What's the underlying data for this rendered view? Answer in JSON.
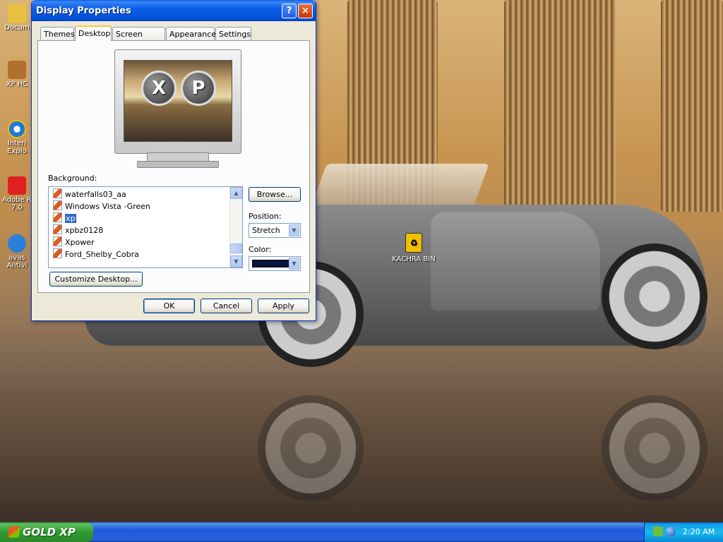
{
  "desktop": {
    "icons": [
      {
        "label": "Docum"
      },
      {
        "label": "XP HC"
      },
      {
        "label": "Interi Explo"
      },
      {
        "label": "Adobe R 7.0"
      },
      {
        "label": "avas Antivi"
      }
    ],
    "recycle_bin": {
      "label": "KACHRA BIN"
    }
  },
  "dialog": {
    "title": "Display Properties",
    "help_button": "?",
    "close_button": "×",
    "tabs": [
      {
        "label": "Themes"
      },
      {
        "label": "Desktop",
        "active": true
      },
      {
        "label": "Screen Saver"
      },
      {
        "label": "Appearance"
      },
      {
        "label": "Settings"
      }
    ],
    "preview": {
      "letter_1": "X",
      "letter_2": "P"
    },
    "background_label": "Background:",
    "background_list": [
      {
        "name": "waterfalls03_aa"
      },
      {
        "name": "Windows Vista -Green"
      },
      {
        "name": "xp",
        "selected": true
      },
      {
        "name": "xpbz0128"
      },
      {
        "name": "Xpower"
      },
      {
        "name": "Ford_Shelby_Cobra"
      }
    ],
    "browse_button": "Browse...",
    "position_label": "Position:",
    "position_value": "Stretch",
    "color_label": "Color:",
    "color_value": "#0a1440",
    "customize_button": "Customize Desktop...",
    "ok_button": "OK",
    "cancel_button": "Cancel",
    "apply_button": "Apply"
  },
  "taskbar": {
    "start_label": "GOLD XP",
    "clock": "2:20 AM"
  },
  "colors": {
    "titlebar": "#0a5de8",
    "selection": "#316ac5",
    "taskbar": "#2157d7",
    "start_button": "#2f9a2f"
  }
}
